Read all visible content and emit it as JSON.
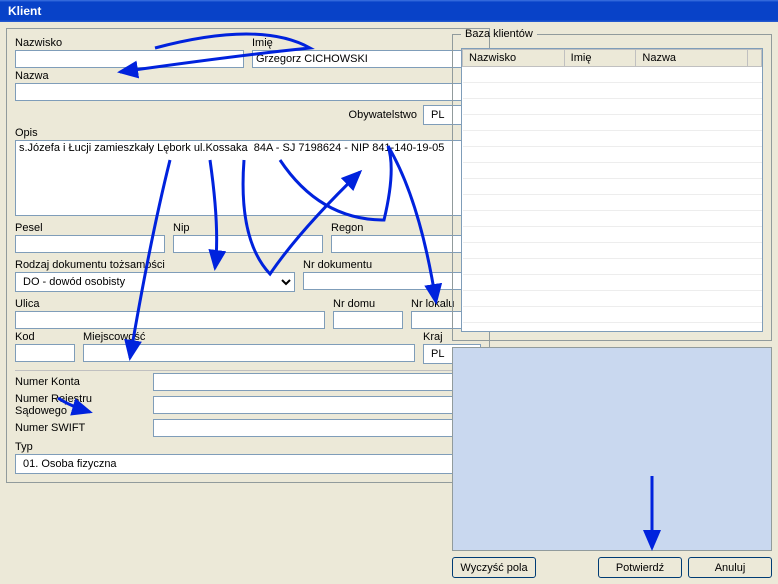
{
  "window": {
    "title": "Klient"
  },
  "labels": {
    "nazwisko": "Nazwisko",
    "imie": "Imię",
    "nazwa": "Nazwa",
    "obywatelstwo": "Obywatelstwo",
    "opis": "Opis",
    "pesel": "Pesel",
    "nip": "Nip",
    "regon": "Regon",
    "rodzaj_dok": "Rodzaj dokumentu tożsamości",
    "nr_dok": "Nr dokumentu",
    "ulica": "Ulica",
    "nr_domu": "Nr domu",
    "nr_lokalu": "Nr lokalu",
    "kod": "Kod",
    "miejscowosc": "Miejscowość",
    "kraj": "Kraj",
    "numer_konta": "Numer Konta",
    "numer_rejestru": "Numer Rejestru Sądowego",
    "numer_swift": "Numer SWIFT",
    "typ": "Typ"
  },
  "values": {
    "nazwisko": "",
    "imie": "Grzegorz CICHOWSKI",
    "nazwa": "",
    "obywatelstwo": "PL",
    "opis": "s.Józefa i Łucji zamieszkały Lębork ul.Kossaka  84A - SJ 7198624 - NIP 841-140-19-05",
    "pesel": "",
    "nip": "",
    "regon": "",
    "rodzaj_dok": "DO - dowód osobisty",
    "nr_dok": "",
    "ulica": "",
    "nr_domu": "",
    "nr_lokalu": "",
    "kod": "",
    "miejscowosc": "",
    "kraj": "PL",
    "numer_konta": "",
    "numer_rejestru": "",
    "numer_swift": "",
    "typ": "01. Osoba fizyczna"
  },
  "baza": {
    "legend": "Baza klientów",
    "columns": [
      "Nazwisko",
      "Imię",
      "Nazwa"
    ],
    "rows": []
  },
  "buttons": {
    "wyczysc": "Wyczyść pola",
    "potwierdz": "Potwierdź",
    "anuluj": "Anuluj"
  }
}
